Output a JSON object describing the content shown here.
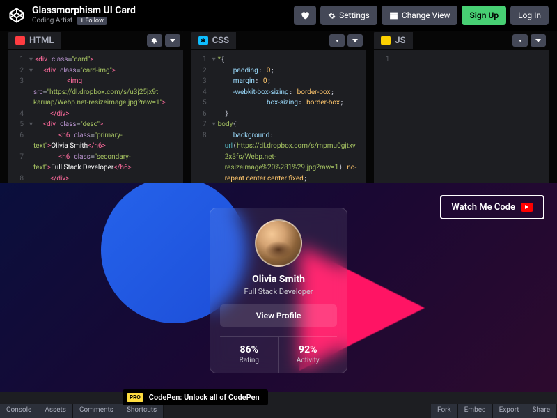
{
  "header": {
    "title": "Glassmorphism UI Card",
    "author": "Coding Artist",
    "follow": "+ Follow",
    "buttons": {
      "settings": "Settings",
      "change_view": "Change View",
      "signup": "Sign Up",
      "login": "Log In"
    }
  },
  "editors": {
    "html": {
      "label": "HTML"
    },
    "css": {
      "label": "CSS"
    },
    "js": {
      "label": "JS"
    }
  },
  "preview": {
    "watch_btn": "Watch Me Code",
    "card": {
      "name": "Olivia Smith",
      "role": "Full Stack Developer",
      "view_btn": "View Profile",
      "stat1_val": "86%",
      "stat1_lbl": "Rating",
      "stat2_val": "92%",
      "stat2_lbl": "Activity"
    }
  },
  "footer": {
    "tabs": {
      "console": "Console",
      "assets": "Assets",
      "comments": "Comments",
      "shortcuts": "Shortcuts",
      "fork": "Fork",
      "embed": "Embed",
      "export": "Export",
      "share": "Share"
    },
    "promo": "CodePen: Unlock all of CodePen",
    "pro": "PRO"
  }
}
